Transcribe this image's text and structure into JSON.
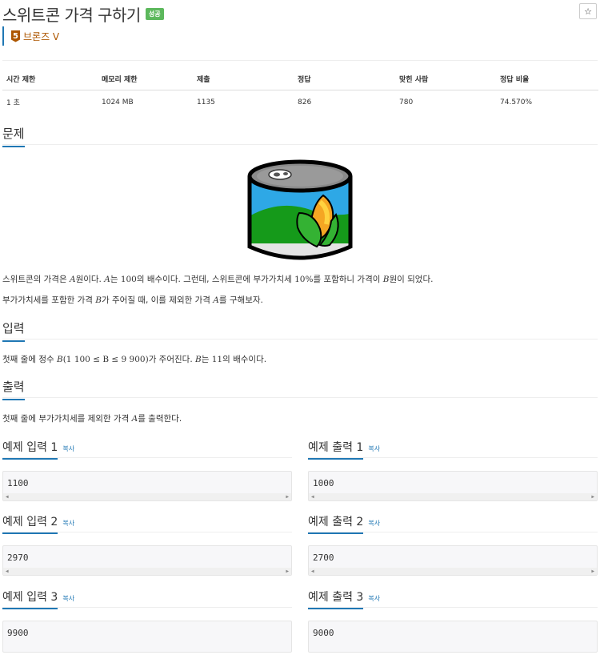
{
  "problem": {
    "title": "스위트콘 가격 구하기",
    "status_badge": "성공",
    "star_label": "☆",
    "tier_level": "5",
    "tier_label": "브론즈 V"
  },
  "info_table": {
    "headers": [
      "시간 제한",
      "메모리 제한",
      "제출",
      "정답",
      "맞힌 사람",
      "정답 비율"
    ],
    "values": [
      "1 초",
      "1024 MB",
      "1135",
      "826",
      "780",
      "74.570%"
    ]
  },
  "sections": {
    "description_title": "문제",
    "description_p1_a": "스위트콘의 가격은 ",
    "description_p1_A": "A",
    "description_p1_b": "원이다. ",
    "description_p1_A2": "A",
    "description_p1_c": "는 ",
    "description_p1_100": "100",
    "description_p1_d": "의 배수이다. 그런데, 스위트콘에 부가가치세 ",
    "description_p1_10": "10%",
    "description_p1_e": "를 포함하니 가격이 ",
    "description_p1_B": "B",
    "description_p1_f": "원이 되었다.",
    "description_p2_a": "부가가치세를 포함한 가격 ",
    "description_p2_B": "B",
    "description_p2_b": "가 주어질 때, 이를 제외한 가격 ",
    "description_p2_A": "A",
    "description_p2_c": "를 구해보자.",
    "input_title": "입력",
    "input_a": "첫째 줄에 정수 ",
    "input_math": "B",
    "input_range": "(1 100 ≤ B ≤ 9 900)",
    "input_b": "가 주어진다. ",
    "input_B2": "B",
    "input_c": "는 ",
    "input_11": "11",
    "input_d": "의 배수이다.",
    "output_title": "출력",
    "output_a": "첫째 줄에 부가가치세를 제외한 가격 ",
    "output_A": "A",
    "output_b": "를 출력한다."
  },
  "examples": [
    {
      "in_title": "예제 입력 1",
      "out_title": "예제 출력 1",
      "copy": "복사",
      "input": "1100",
      "output": "1000"
    },
    {
      "in_title": "예제 입력 2",
      "out_title": "예제 출력 2",
      "copy": "복사",
      "input": "2970",
      "output": "2700"
    },
    {
      "in_title": "예제 입력 3",
      "out_title": "예제 출력 3",
      "copy": "복사",
      "input": "9900",
      "output": "9000"
    }
  ]
}
